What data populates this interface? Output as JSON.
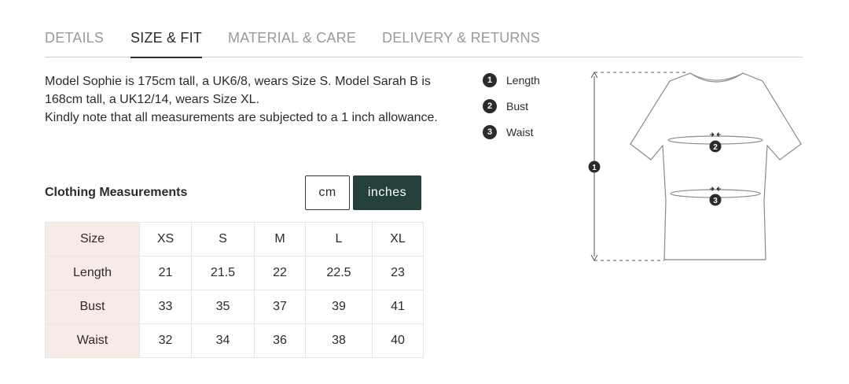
{
  "tabs": [
    {
      "label": "DETAILS",
      "active": false
    },
    {
      "label": "SIZE & FIT",
      "active": true
    },
    {
      "label": "MATERIAL & CARE",
      "active": false
    },
    {
      "label": "DELIVERY & RETURNS",
      "active": false
    }
  ],
  "description": {
    "line1": "Model Sophie is 175cm tall, a UK6/8, wears Size S. Model Sarah B is 168cm tall, a UK12/14, wears Size XL.",
    "line2": "Kindly note that all measurements are subjected to a 1 inch allowance."
  },
  "measurements": {
    "title": "Clothing Measurements",
    "units": {
      "cm": "cm",
      "inches": "inches",
      "selected": "inches"
    }
  },
  "table": {
    "header": [
      "Size",
      "XS",
      "S",
      "M",
      "L",
      "XL"
    ],
    "rows": [
      [
        "Length",
        "21",
        "21.5",
        "22",
        "22.5",
        "23"
      ],
      [
        "Bust",
        "33",
        "35",
        "37",
        "39",
        "41"
      ],
      [
        "Waist",
        "32",
        "34",
        "36",
        "38",
        "40"
      ]
    ]
  },
  "legend": [
    {
      "num": "1",
      "label": "Length"
    },
    {
      "num": "2",
      "label": "Bust"
    },
    {
      "num": "3",
      "label": "Waist"
    }
  ],
  "diagram": {
    "markers": [
      "1",
      "2",
      "3"
    ]
  },
  "colors": {
    "accent": "#24403c",
    "header_bg": "#f8ebe7",
    "muted_tab": "#9a9a9a",
    "text": "#2b2b2b"
  }
}
